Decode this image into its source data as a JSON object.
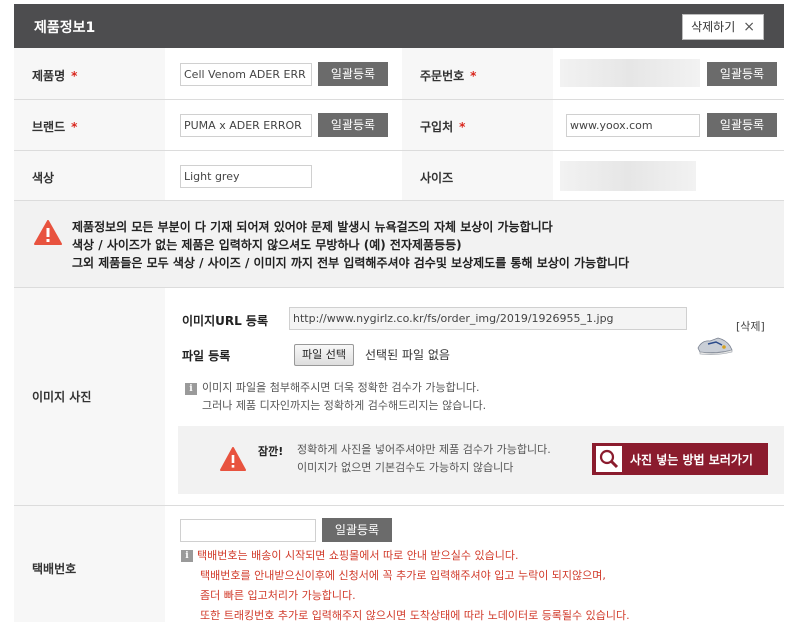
{
  "header": {
    "title": "제품정보1",
    "delete_label": "삭제하기",
    "delete_x": "×"
  },
  "product_name": {
    "label": "제품명",
    "required": "*",
    "value": "Cell Venom  ADER ERR",
    "btn": "일괄등록"
  },
  "order_no": {
    "label": "주문번호",
    "required": "*",
    "btn": "일괄등록"
  },
  "brand": {
    "label": "브랜드",
    "required": "*",
    "value": "PUMA x ADER ERROR",
    "btn": "일괄등록"
  },
  "shop": {
    "label": "구입처",
    "required": "*",
    "value": "www.yoox.com",
    "btn": "일괄등록"
  },
  "color": {
    "label": "색상",
    "value": "Light grey"
  },
  "size": {
    "label": "사이즈"
  },
  "notice": {
    "icon": "warning-icon",
    "lines": [
      "제품정보의 모든 부분이 다 기재 되어져 있어야 문제 발생시 뉴욕걸즈의 자체 보상이 가능합니다",
      "색상 / 사이즈가 없는 제품은 입력하지 않으셔도 무방하나 (예) 전자제품등등)",
      "그외 제품들은 모두 색상 / 사이즈 / 이미지 까지 전부 입력해주셔야 검수및 보상제도를 통해 보상이 가능합니다"
    ]
  },
  "image": {
    "label": "이미지 사진",
    "url_label": "이미지URL 등록",
    "url_value": "http://www.nygirlz.co.kr/fs/order_img/2019/1926955_1.jpg",
    "delete_link": "[삭제]",
    "file_label": "파일 등록",
    "file_btn": "파일 선택",
    "file_status": "선택된 파일 없음",
    "info_icon": "i",
    "info_lines": [
      "이미지 파일을 첨부해주시면 더욱 정확한 검수가 가능합니다.",
      "그러나 제품 디자인까지는 정확하게 검수해드리지는 않습니다."
    ],
    "tip_title": "잠깐!",
    "tip_lines": [
      "정확하게 사진을 넣어주셔야만 제품 검수가 가능합니다.",
      "이미지가 없으면 기본검수도 가능하지 않습니다"
    ],
    "howto_btn": "사진 넣는 방법 보러가기"
  },
  "tracking": {
    "label": "택배번호",
    "btn": "일괄등록",
    "info_icon": "i",
    "lines": [
      "택배번호는 배송이 시작되면 쇼핑몰에서 따로 안내 받으실수 있습니다.",
      "택배번호를 안내받으신이후에 신청서에 꼭 추가로 입력해주셔야 입고 누락이 되지않으며,",
      "좀더 빠른 입고처리가 가능합니다.",
      "또한 트래킹번호 추가로 입력해주지 않으시면 도착상태에 따라 노데이터로 등록될수 있습니다."
    ]
  },
  "colors": {
    "header_bg": "#4d4d4f",
    "button_gray": "#6b6b6b",
    "howto_bg": "#8b1c2e",
    "required": "#d9251c",
    "warn_red": "#e8533f",
    "note_red": "#d13a2a"
  }
}
